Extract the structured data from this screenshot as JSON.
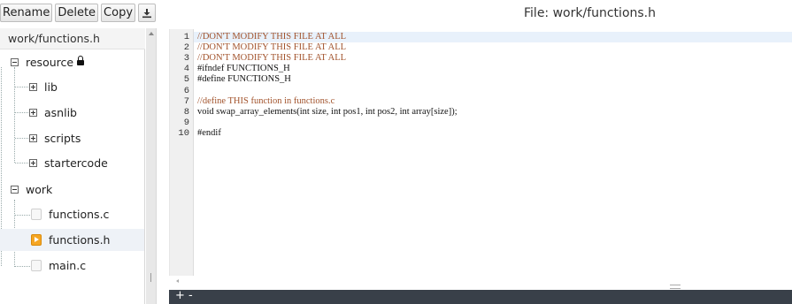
{
  "toolbar": {
    "rename_label": "Rename",
    "delete_label": "Delete",
    "copy_label": "Copy",
    "download_icon": "download-icon"
  },
  "file_title": "File: work/functions.h",
  "tree": {
    "path": "work/functions.h",
    "resource": {
      "label": "resource",
      "locked": true,
      "children": [
        "lib",
        "asnlib",
        "scripts",
        "startercode"
      ]
    },
    "work": {
      "label": "work",
      "children": [
        "functions.c",
        "functions.h",
        "main.c"
      ],
      "selected": "functions.h"
    }
  },
  "editor": {
    "line_numbers": [
      "1",
      "2",
      "3",
      "4",
      "5",
      "6",
      "7",
      "8",
      "9",
      "10"
    ],
    "lines": [
      "//DON'T MODIFY THIS FILE AT ALL",
      "//DON'T MODIFY THIS FILE AT ALL",
      "//DON'T MODIFY THIS FILE AT ALL",
      "#ifndef FUNCTIONS_H",
      "#define FUNCTIONS_H",
      "",
      "//define THIS function in functions.c",
      "void swap_array_elements(int size, int pos1, int pos2, int array[size]);",
      "",
      "#endif"
    ]
  },
  "console": {
    "plus_label": "+",
    "minus_label": "-"
  },
  "colors": {
    "comment": "#a2532c",
    "console_bg": "#394049",
    "selected_file_icon": "#f5a623"
  }
}
